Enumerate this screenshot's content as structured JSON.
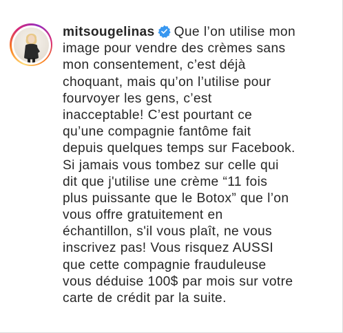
{
  "post": {
    "username": "mitsougelinas",
    "verified": true,
    "caption_lines": [
      "Que l’on utilise mon",
      "image pour vendre des crèmes sans",
      "mon consentement, c’est déjà",
      "choquant, mais qu’on l’utilise pour",
      "fourvoyer les gens, c’est",
      "inacceptable! C’est pourtant ce",
      "qu’une compagnie fantôme fait",
      "depuis quelques temps sur Facebook.",
      "Si jamais vous tombez sur celle qui",
      "dit que j'utilise une crème “11 fois",
      "plus puissante que le Botox” que l’on",
      "vous offre gratuitement en",
      "échantillon, s'il vous plaît, ne vous",
      "inscrivez pas! Vous risquez AUSSI",
      "que cette compagnie frauduleuse",
      "vous déduise 100$ par mois sur votre",
      "carte de crédit par la suite."
    ]
  },
  "icons": {
    "verified": "verified-badge-icon",
    "avatar": "profile-photo"
  },
  "colors": {
    "text": "#262626",
    "verified_badge": "#3897f0",
    "story_ring": [
      "#feda75",
      "#fa7e1e",
      "#d62976",
      "#962fbf"
    ]
  }
}
